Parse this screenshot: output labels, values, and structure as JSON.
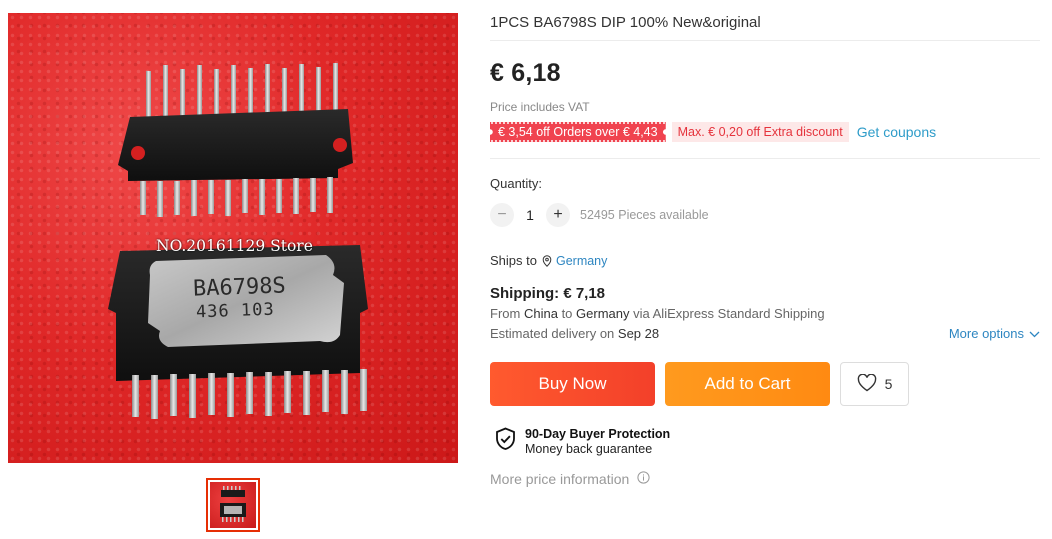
{
  "product": {
    "title": "1PCS BA6798S DIP 100% New&original",
    "price": "€ 6,18",
    "vat_note": "Price includes VAT",
    "image_label": "NO.20161129 Store",
    "chip_marking_line1": "BA6798S",
    "chip_marking_line2": "436 103"
  },
  "coupons": {
    "primary": "€ 3,54 off Orders over € 4,43",
    "secondary": "Max. € 0,20 off Extra discount",
    "get_coupons": "Get coupons"
  },
  "quantity": {
    "label": "Quantity:",
    "value": "1",
    "minus": "−",
    "plus": "+",
    "available": "52495 Pieces available"
  },
  "shipping": {
    "ships_to_label": "Ships to",
    "country": "Germany",
    "cost": "Shipping: € 7,18",
    "from_word": "From",
    "from_country": "China",
    "to_word": "to",
    "to_country": "Germany",
    "via": "via AliExpress Standard Shipping",
    "eta_label": "Estimated delivery on",
    "eta_date": "Sep 28",
    "more_options": "More options"
  },
  "actions": {
    "buy_now": "Buy Now",
    "add_to_cart": "Add to Cart",
    "wishlist_count": "5"
  },
  "protection": {
    "title": "90-Day Buyer Protection",
    "subtitle": "Money back guarantee"
  },
  "more_price_info": "More price information",
  "colors": {
    "buy_now": "#f3402a",
    "add_to_cart": "#ff8a12",
    "coupon_red": "#f0434f",
    "link_blue": "#2e86c1",
    "thumb_border": "#e62e04"
  }
}
